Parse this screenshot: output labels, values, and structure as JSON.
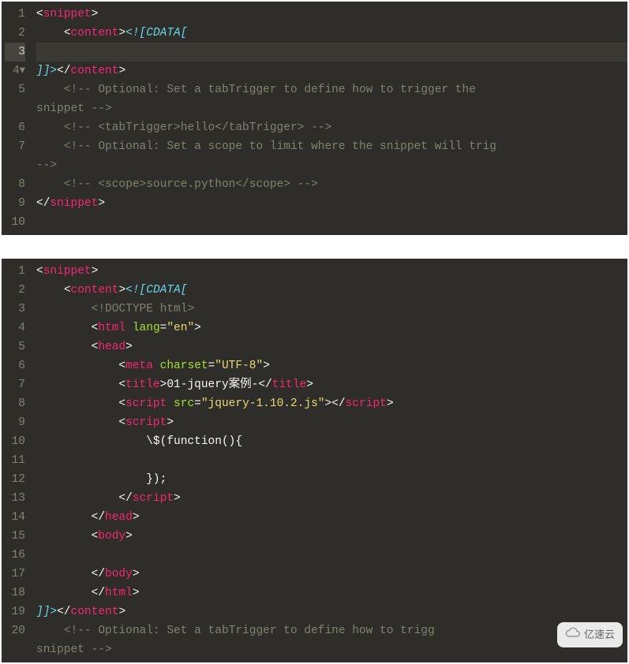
{
  "editor1": {
    "active_line": 3,
    "fold_line": 4,
    "lines": [
      {
        "n": 1,
        "segs": [
          [
            "punc",
            "<"
          ],
          [
            "tag",
            "snippet"
          ],
          [
            "punc",
            ">"
          ]
        ]
      },
      {
        "n": 2,
        "segs": [
          [
            "txt",
            "    "
          ],
          [
            "punc",
            "<"
          ],
          [
            "tag",
            "content"
          ],
          [
            "punc",
            ">"
          ],
          [
            "kw",
            "<![CDATA["
          ]
        ]
      },
      {
        "n": 3,
        "segs": []
      },
      {
        "n": 4,
        "segs": [
          [
            "kw",
            "]]>"
          ],
          [
            "punc",
            "</"
          ],
          [
            "tag",
            "content"
          ],
          [
            "punc",
            ">"
          ]
        ]
      },
      {
        "n": 5,
        "segs": [
          [
            "txt",
            "    "
          ],
          [
            "cmt",
            "<!-- Optional: Set a tabTrigger to define how to trigger the "
          ]
        ]
      },
      {
        "n": "",
        "segs": [
          [
            "cmt",
            "snippet -->"
          ]
        ]
      },
      {
        "n": 6,
        "segs": [
          [
            "txt",
            "    "
          ],
          [
            "cmt",
            "<!-- <tabTrigger>hello</tabTrigger> -->"
          ]
        ]
      },
      {
        "n": 7,
        "segs": [
          [
            "txt",
            "    "
          ],
          [
            "cmt",
            "<!-- Optional: Set a scope to limit where the snippet will trig"
          ]
        ]
      },
      {
        "n": "",
        "segs": [
          [
            "cmt",
            "-->"
          ]
        ]
      },
      {
        "n": 8,
        "segs": [
          [
            "txt",
            "    "
          ],
          [
            "cmt",
            "<!-- <scope>source.python</scope> -->"
          ]
        ]
      },
      {
        "n": 9,
        "segs": [
          [
            "punc",
            "</"
          ],
          [
            "tag",
            "snippet"
          ],
          [
            "punc",
            ">"
          ]
        ]
      },
      {
        "n": 10,
        "segs": []
      }
    ]
  },
  "editor2": {
    "lines": [
      {
        "n": 1,
        "segs": [
          [
            "punc",
            "<"
          ],
          [
            "tag",
            "snippet"
          ],
          [
            "punc",
            ">"
          ]
        ]
      },
      {
        "n": 2,
        "segs": [
          [
            "txt",
            "    "
          ],
          [
            "punc",
            "<"
          ],
          [
            "tag",
            "content"
          ],
          [
            "punc",
            ">"
          ],
          [
            "kw",
            "<![CDATA["
          ]
        ]
      },
      {
        "n": 3,
        "segs": [
          [
            "txt",
            "        "
          ],
          [
            "cmt",
            "<!DOCTYPE html>"
          ]
        ]
      },
      {
        "n": 4,
        "segs": [
          [
            "txt",
            "        "
          ],
          [
            "punc",
            "<"
          ],
          [
            "tag",
            "html"
          ],
          [
            "txt",
            " "
          ],
          [
            "attr",
            "lang"
          ],
          [
            "punc",
            "="
          ],
          [
            "str",
            "\"en\""
          ],
          [
            "punc",
            ">"
          ]
        ]
      },
      {
        "n": 5,
        "segs": [
          [
            "txt",
            "        "
          ],
          [
            "punc",
            "<"
          ],
          [
            "tag",
            "head"
          ],
          [
            "punc",
            ">"
          ]
        ]
      },
      {
        "n": 6,
        "segs": [
          [
            "txt",
            "            "
          ],
          [
            "punc",
            "<"
          ],
          [
            "tag",
            "meta"
          ],
          [
            "txt",
            " "
          ],
          [
            "attr",
            "charset"
          ],
          [
            "punc",
            "="
          ],
          [
            "str",
            "\"UTF-8\""
          ],
          [
            "punc",
            ">"
          ]
        ]
      },
      {
        "n": 7,
        "segs": [
          [
            "txt",
            "            "
          ],
          [
            "punc",
            "<"
          ],
          [
            "tag",
            "title"
          ],
          [
            "punc",
            ">"
          ],
          [
            "txt",
            "01-jquery案例-"
          ],
          [
            "punc",
            "</"
          ],
          [
            "tag",
            "title"
          ],
          [
            "punc",
            ">"
          ]
        ]
      },
      {
        "n": 8,
        "segs": [
          [
            "txt",
            "            "
          ],
          [
            "punc",
            "<"
          ],
          [
            "tag",
            "script"
          ],
          [
            "txt",
            " "
          ],
          [
            "attr",
            "src"
          ],
          [
            "punc",
            "="
          ],
          [
            "str",
            "\"jquery-1.10.2.js\""
          ],
          [
            "punc",
            ">"
          ],
          [
            "punc",
            "</"
          ],
          [
            "tag",
            "script"
          ],
          [
            "punc",
            ">"
          ]
        ]
      },
      {
        "n": 9,
        "segs": [
          [
            "txt",
            "            "
          ],
          [
            "punc",
            "<"
          ],
          [
            "tag",
            "script"
          ],
          [
            "punc",
            ">"
          ]
        ]
      },
      {
        "n": 10,
        "segs": [
          [
            "txt",
            "                \\$(function(){"
          ]
        ]
      },
      {
        "n": 11,
        "segs": []
      },
      {
        "n": 12,
        "segs": [
          [
            "txt",
            "                });"
          ]
        ]
      },
      {
        "n": 13,
        "segs": [
          [
            "txt",
            "            "
          ],
          [
            "punc",
            "</"
          ],
          [
            "tag",
            "script"
          ],
          [
            "punc",
            ">"
          ]
        ]
      },
      {
        "n": 14,
        "segs": [
          [
            "txt",
            "        "
          ],
          [
            "punc",
            "</"
          ],
          [
            "tag",
            "head"
          ],
          [
            "punc",
            ">"
          ]
        ]
      },
      {
        "n": 15,
        "segs": [
          [
            "txt",
            "        "
          ],
          [
            "punc",
            "<"
          ],
          [
            "tag",
            "body"
          ],
          [
            "punc",
            ">"
          ]
        ]
      },
      {
        "n": 16,
        "segs": []
      },
      {
        "n": 17,
        "segs": [
          [
            "txt",
            "        "
          ],
          [
            "punc",
            "</"
          ],
          [
            "tag",
            "body"
          ],
          [
            "punc",
            ">"
          ]
        ]
      },
      {
        "n": 18,
        "segs": [
          [
            "txt",
            "        "
          ],
          [
            "punc",
            "</"
          ],
          [
            "tag",
            "html"
          ],
          [
            "punc",
            ">"
          ]
        ]
      },
      {
        "n": 19,
        "segs": [
          [
            "kw",
            "]]>"
          ],
          [
            "punc",
            "</"
          ],
          [
            "tag",
            "content"
          ],
          [
            "punc",
            ">"
          ]
        ]
      },
      {
        "n": 20,
        "segs": [
          [
            "txt",
            "    "
          ],
          [
            "cmt",
            "<!-- Optional: Set a tabTrigger to define how to trigg"
          ]
        ]
      },
      {
        "n": "",
        "segs": [
          [
            "cmt",
            "snippet -->"
          ]
        ]
      }
    ]
  },
  "watermark": {
    "text": "亿速云"
  }
}
